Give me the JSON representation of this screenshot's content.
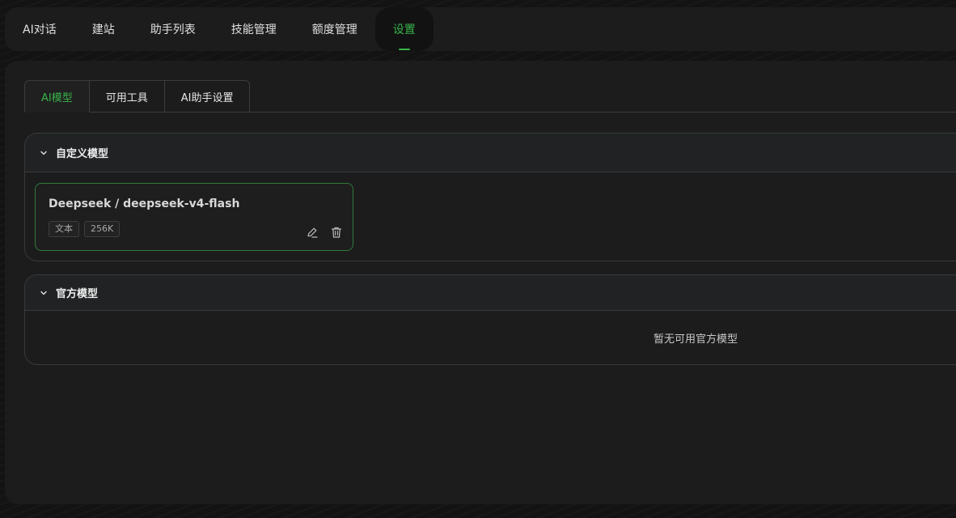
{
  "nav": {
    "items": [
      {
        "label": "AI对话",
        "active": false
      },
      {
        "label": "建站",
        "active": false
      },
      {
        "label": "助手列表",
        "active": false
      },
      {
        "label": "技能管理",
        "active": false
      },
      {
        "label": "额度管理",
        "active": false
      },
      {
        "label": "设置",
        "active": true
      }
    ]
  },
  "subtabs": [
    {
      "label": "AI模型",
      "active": true
    },
    {
      "label": "可用工具",
      "active": false
    },
    {
      "label": "AI助手设置",
      "active": false
    }
  ],
  "custom_section": {
    "title": "自定义模型",
    "models": [
      {
        "name": "Deepseek / deepseek-v4-flash",
        "tags": [
          "文本",
          "256K"
        ]
      }
    ]
  },
  "official_section": {
    "title": "官方模型",
    "empty_text": "暂无可用官方模型"
  },
  "colors": {
    "accent": "#38b24a",
    "background": "#1c1c1c",
    "border": "#3a3a3a"
  },
  "icons": {
    "chevron": "chevron-down-icon",
    "edit": "pencil-icon",
    "delete": "trash-icon"
  }
}
